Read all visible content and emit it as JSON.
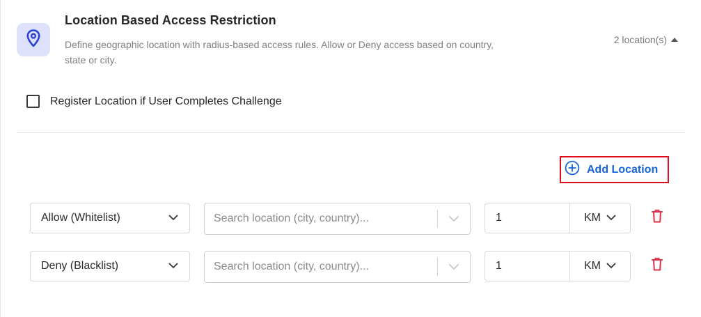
{
  "header": {
    "title": "Location Based Access Restriction",
    "description": "Define geographic location with radius-based access rules. Allow or Deny access based on country, state or city.",
    "location_count": "2 location(s)",
    "icon": "map-pin-icon"
  },
  "register_option": {
    "label": "Register Location if User Completes Challenge",
    "checked": false
  },
  "add_location_label": "Add Location",
  "rules": [
    {
      "policy": "Allow (Whitelist)",
      "search_placeholder": "Search location (city, country)...",
      "radius": "1",
      "unit": "KM"
    },
    {
      "policy": "Deny (Blacklist)",
      "search_placeholder": "Search location (city, country)...",
      "radius": "1",
      "unit": "KM"
    }
  ],
  "colors": {
    "accent_blue": "#1665d8",
    "highlight_red": "#e10b1c",
    "delete_red": "#e0324a",
    "icon_badge_bg": "#dde1fb",
    "pin_color": "#2b3fd6"
  }
}
